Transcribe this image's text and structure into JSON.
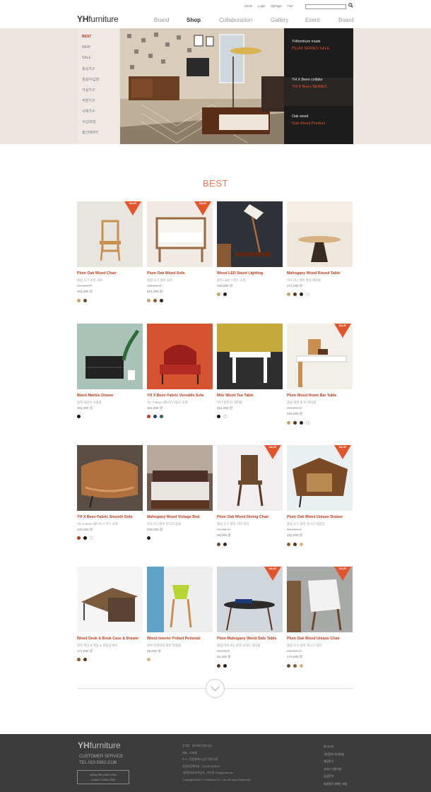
{
  "header": {
    "util_links": [
      "Home",
      "Login",
      "MyPage",
      "Cart"
    ],
    "search_placeholder": "",
    "logo_bold": "YH",
    "logo_light": "furniture",
    "nav": [
      "Brand",
      "Shop",
      "Collaboration",
      "Gallery",
      "Event",
      "Board"
    ],
    "nav_active": "Shop"
  },
  "hero": {
    "categories": [
      "BEST",
      "NEW",
      "SALE",
      "침실가구",
      "침실/수납장",
      "거실가구",
      "주방가구",
      "서재가구",
      "수납/보관",
      "홈인테리어"
    ],
    "promos": [
      {
        "line1": "YHfurniture made",
        "line2": "PLUM SERIES SALE"
      },
      {
        "line1": "YH X Been collabo",
        "line2": "YH X Been SERIES"
      },
      {
        "line1": "Oak wood",
        "line2": "Oak Wood Product"
      }
    ]
  },
  "best": {
    "title": "BEST",
    "sale_label": "SALE!",
    "products": [
      {
        "name": "Plum Oak Wood Chair",
        "desc": "플럼 오크 원목 의자",
        "orig": "560,000 원",
        "price": "461,000 원",
        "sale": true,
        "colors": [
          "#c9a06b",
          "#6b4a2e"
        ]
      },
      {
        "name": "Plum Oak Wood Sofa",
        "desc": "플럼 오크 원목 소파",
        "orig": "685,000 원",
        "price": "561,000 원",
        "sale": true,
        "colors": [
          "#c9a06b",
          "#8a5a35",
          "#3a2418"
        ]
      },
      {
        "name": "Wood LED Stand Lighting",
        "desc": "원목 LED 스탠드 조명",
        "orig": "",
        "price": "240,000 원",
        "sale": false,
        "colors": [
          "#c9a06b",
          "#222222"
        ]
      },
      {
        "name": "Mahogany Wood Round Table",
        "desc": "마호가니 원목 원형 테이블",
        "orig": "",
        "price": "271,000 원",
        "sale": false,
        "colors": [
          "#c9a06b",
          "#5a3620",
          "#222222",
          "#ffffff"
        ]
      },
      {
        "name": "Black Marble Drawer",
        "desc": "블랙 대리석 서랍장",
        "orig": "",
        "price": "461,000 원",
        "sale": false,
        "colors": [
          "#111111"
        ]
      },
      {
        "name": "YH X Been Fabric Versatile Sofa",
        "desc": "YH X Been 패브릭 다용도 소파",
        "orig": "",
        "price": "461,000 원",
        "sale": false,
        "colors": [
          "#c0391b",
          "#1e3a7a",
          "#2f6b3a"
        ]
      },
      {
        "name": "Mini Wood Tea Table",
        "desc": "미니 원목 티 테이블",
        "orig": "",
        "price": "461,000 원",
        "sale": false,
        "colors": [
          "#111111",
          "#ffffff"
        ]
      },
      {
        "name": "Plum Wood Home Bar Table",
        "desc": "플럼 원목 홈 바 테이블",
        "orig": "350,000 원",
        "price": "226,000 원",
        "sale": true,
        "colors": [
          "#c9a06b",
          "#5a3620",
          "#222222",
          "#ffffff"
        ]
      },
      {
        "name": "YH X Been Fabric Smooth Sofa",
        "desc": "YH X Been 패브릭 스무스 소파",
        "orig": "",
        "price": "430,000 원",
        "sale": false,
        "colors": [
          "#c0391b",
          "#111111",
          "#ffffff"
        ]
      },
      {
        "name": "Mahogany Wood Vintage Bed",
        "desc": "마호가니 원목 빈티지 침대",
        "orig": "",
        "price": "539,000 원",
        "sale": false,
        "colors": [
          "#222222"
        ]
      },
      {
        "name": "Plum Oak Wood Dining Chair",
        "desc": "플럼 오크 원목 식탁 의자",
        "orig": "70,000 원",
        "price": "58,000 원",
        "sale": true,
        "colors": [
          "#6b4a2e",
          "#3a2418"
        ]
      },
      {
        "name": "Plum Oak Wood Unique Drawer",
        "desc": "플럼 오크 원목 유니크 서랍장",
        "orig": "250,000 원",
        "price": "192,000 원",
        "sale": true,
        "colors": [
          "#8a5a35",
          "#5a3620",
          "#d9b48a"
        ]
      },
      {
        "name": "Wood Desk & Book Case & Drawer",
        "desc": "원목 책상 & 책장 & 서랍장 세트",
        "orig": "",
        "price": "171,000 원",
        "sale": false,
        "colors": [
          "#8a5a35",
          "#5a3620"
        ]
      },
      {
        "name": "Wood Interior Potted Pedestal",
        "desc": "원목 인테리어 화분 받침대",
        "orig": "",
        "price": "39,000 원",
        "sale": false,
        "colors": [
          "#d9b48a"
        ]
      },
      {
        "name": "Plum Mahogany Wood Side Table",
        "desc": "플럼 마호가니 원목 사이드 테이블",
        "orig": "60,000 원",
        "price": "52,000 원",
        "sale": true,
        "colors": [
          "#5a3620",
          "#222222"
        ]
      },
      {
        "name": "Plum Oak Wood Unique Chair",
        "desc": "플럼 오크 원목 유니크 의자",
        "orig": "200,000 원",
        "price": "170,000 원",
        "sale": true,
        "colors": [
          "#6b4a2e",
          "#8a5a35",
          "#d9b48a"
        ]
      }
    ]
  },
  "footer": {
    "logo_bold": "YH",
    "logo_light": "furniture",
    "cs_title": "CUSTOMER SERVICE",
    "cs_tel": "TEL.010-5362-2136",
    "hours1": "MON-FRI  1030-1730",
    "hours2": "LUNCH   1230-1330",
    "info": [
      "상호명 : 와이에이치퍼니처",
      "대표 : 이보영",
      "주소 : 인천광역시 남구 용현 5동",
      "사업자등록번호 : 123-45-678910",
      "개인정보보호책임자 : 이보영 YH@gmail.com",
      "Copyright©2020 YHfurniture Co., Ltd. All rights Reserved."
    ],
    "links": [
      "회사소개",
      "개인정보 처리방침",
      "매장찾기",
      "서비스 이용약관",
      "입점문의",
      "회원정보 재확인 회원"
    ]
  },
  "colors": {
    "accent": "#e2542a",
    "text_red": "#c0391b",
    "footer_bg": "#3c3c3c"
  }
}
